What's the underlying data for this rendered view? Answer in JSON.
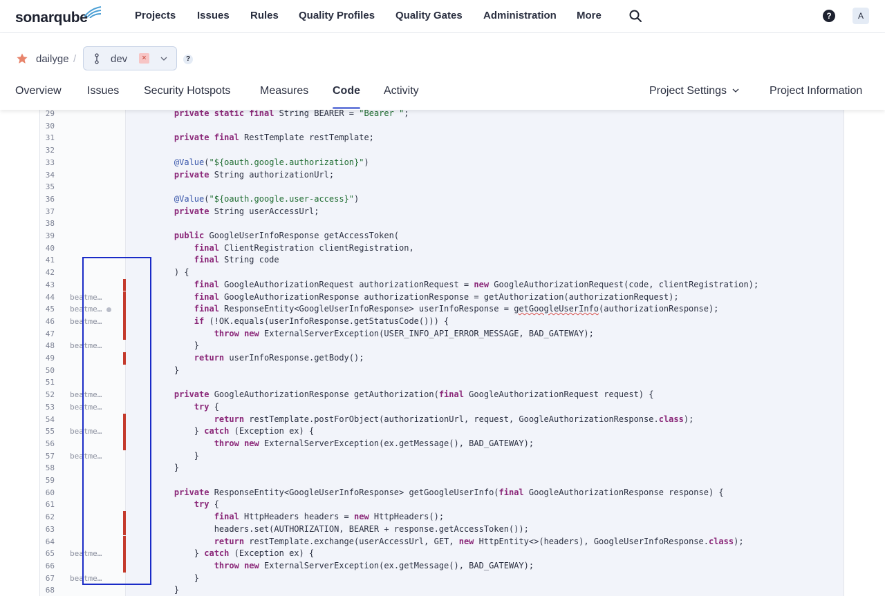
{
  "topnav": {
    "logo_text": "sonarqube",
    "items": [
      "Projects",
      "Issues",
      "Rules",
      "Quality Profiles",
      "Quality Gates",
      "Administration",
      "More"
    ],
    "help_glyph": "?",
    "avatar_letter": "A",
    "icons": [
      "search-icon",
      "help-icon"
    ]
  },
  "project": {
    "name": "dailyge",
    "separator": "/",
    "branch": "dev",
    "branch_remove_glyph": "×",
    "help_glyph": "?",
    "tabs": [
      "Overview",
      "Issues",
      "Security Hotspots",
      "Measures",
      "Code",
      "Activity"
    ],
    "active_tab": "Code",
    "settings_label": "Project Settings",
    "info_label": "Project Information"
  },
  "code": {
    "lines": [
      {
        "n": "29",
        "blame": "",
        "dot": false,
        "cov": false,
        "text": "    private static final String BEARER = \"Bearer \";"
      },
      {
        "n": "30",
        "blame": "",
        "dot": false,
        "cov": false,
        "text": ""
      },
      {
        "n": "31",
        "blame": "",
        "dot": false,
        "cov": false,
        "text": "    private final RestTemplate restTemplate;"
      },
      {
        "n": "32",
        "blame": "",
        "dot": false,
        "cov": false,
        "text": ""
      },
      {
        "n": "33",
        "blame": "",
        "dot": false,
        "cov": false,
        "text": "    @Value(\"${oauth.google.authorization}\")"
      },
      {
        "n": "34",
        "blame": "",
        "dot": false,
        "cov": false,
        "text": "    private String authorizationUrl;"
      },
      {
        "n": "35",
        "blame": "",
        "dot": false,
        "cov": false,
        "text": ""
      },
      {
        "n": "36",
        "blame": "",
        "dot": false,
        "cov": false,
        "text": "    @Value(\"${oauth.google.user-access}\")"
      },
      {
        "n": "37",
        "blame": "",
        "dot": false,
        "cov": false,
        "text": "    private String userAccessUrl;"
      },
      {
        "n": "38",
        "blame": "",
        "dot": false,
        "cov": false,
        "text": ""
      },
      {
        "n": "39",
        "blame": "",
        "dot": false,
        "cov": false,
        "text": "    public GoogleUserInfoResponse getAccessToken("
      },
      {
        "n": "40",
        "blame": "",
        "dot": false,
        "cov": false,
        "text": "        final ClientRegistration clientRegistration,"
      },
      {
        "n": "41",
        "blame": "",
        "dot": false,
        "cov": false,
        "text": "        final String code"
      },
      {
        "n": "42",
        "blame": "",
        "dot": false,
        "cov": false,
        "text": "    ) {"
      },
      {
        "n": "43",
        "blame": "",
        "dot": false,
        "cov": true,
        "text": "        final GoogleAuthorizationRequest authorizationRequest = new GoogleAuthorizationRequest(code, clientRegistration);"
      },
      {
        "n": "44",
        "blame": "beatme…",
        "dot": false,
        "cov": true,
        "text": "        final GoogleAuthorizationResponse authorizationResponse = getAuthorization(authorizationRequest);"
      },
      {
        "n": "45",
        "blame": "beatme…",
        "dot": true,
        "cov": true,
        "text": "        final ResponseEntity<GoogleUserInfoResponse> userInfoResponse = getGoogleUserInfo(authorizationResponse);"
      },
      {
        "n": "46",
        "blame": "beatme…",
        "dot": false,
        "cov": true,
        "text": "        if (!OK.equals(userInfoResponse.getStatusCode())) {"
      },
      {
        "n": "47",
        "blame": "",
        "dot": false,
        "cov": true,
        "text": "            throw new ExternalServerException(USER_INFO_API_ERROR_MESSAGE, BAD_GATEWAY);"
      },
      {
        "n": "48",
        "blame": "beatme…",
        "dot": false,
        "cov": false,
        "text": "        }"
      },
      {
        "n": "49",
        "blame": "",
        "dot": false,
        "cov": true,
        "text": "        return userInfoResponse.getBody();"
      },
      {
        "n": "50",
        "blame": "",
        "dot": false,
        "cov": false,
        "text": "    }"
      },
      {
        "n": "51",
        "blame": "",
        "dot": false,
        "cov": false,
        "text": ""
      },
      {
        "n": "52",
        "blame": "beatme…",
        "dot": false,
        "cov": false,
        "text": "    private GoogleAuthorizationResponse getAuthorization(final GoogleAuthorizationRequest request) {"
      },
      {
        "n": "53",
        "blame": "beatme…",
        "dot": false,
        "cov": false,
        "text": "        try {"
      },
      {
        "n": "54",
        "blame": "",
        "dot": false,
        "cov": true,
        "text": "            return restTemplate.postForObject(authorizationUrl, request, GoogleAuthorizationResponse.class);"
      },
      {
        "n": "55",
        "blame": "beatme…",
        "dot": false,
        "cov": true,
        "text": "        } catch (Exception ex) {"
      },
      {
        "n": "56",
        "blame": "",
        "dot": false,
        "cov": true,
        "text": "            throw new ExternalServerException(ex.getMessage(), BAD_GATEWAY);"
      },
      {
        "n": "57",
        "blame": "beatme…",
        "dot": false,
        "cov": false,
        "text": "        }"
      },
      {
        "n": "58",
        "blame": "",
        "dot": false,
        "cov": false,
        "text": "    }"
      },
      {
        "n": "59",
        "blame": "",
        "dot": false,
        "cov": false,
        "text": ""
      },
      {
        "n": "60",
        "blame": "",
        "dot": false,
        "cov": false,
        "text": "    private ResponseEntity<GoogleUserInfoResponse> getGoogleUserInfo(final GoogleAuthorizationResponse response) {"
      },
      {
        "n": "61",
        "blame": "",
        "dot": false,
        "cov": false,
        "text": "        try {"
      },
      {
        "n": "62",
        "blame": "",
        "dot": false,
        "cov": true,
        "text": "            final HttpHeaders headers = new HttpHeaders();"
      },
      {
        "n": "63",
        "blame": "",
        "dot": false,
        "cov": true,
        "text": "            headers.set(AUTHORIZATION, BEARER + response.getAccessToken());"
      },
      {
        "n": "64",
        "blame": "",
        "dot": false,
        "cov": true,
        "text": "            return restTemplate.exchange(userAccessUrl, GET, new HttpEntity<>(headers), GoogleUserInfoResponse.class);"
      },
      {
        "n": "65",
        "blame": "beatme…",
        "dot": false,
        "cov": true,
        "text": "        } catch (Exception ex) {"
      },
      {
        "n": "66",
        "blame": "",
        "dot": false,
        "cov": true,
        "text": "            throw new ExternalServerException(ex.getMessage(), BAD_GATEWAY);"
      },
      {
        "n": "67",
        "blame": "beatme…",
        "dot": false,
        "cov": false,
        "text": "        }"
      },
      {
        "n": "68",
        "blame": "",
        "dot": false,
        "cov": false,
        "text": "    }"
      }
    ]
  }
}
